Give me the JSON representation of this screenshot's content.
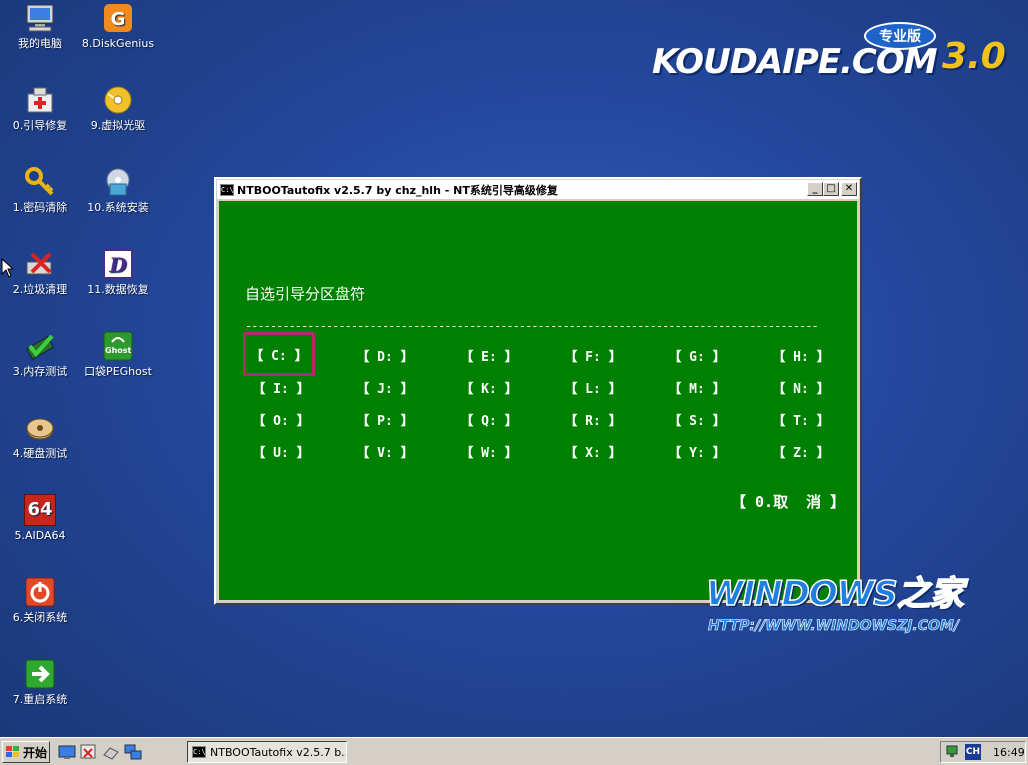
{
  "desktop": {
    "icons": [
      {
        "label": "我的电脑",
        "icon": "computer-icon"
      },
      {
        "label": "8.DiskGenius",
        "icon": "diskgenius-icon"
      },
      {
        "label": "0.引导修复",
        "icon": "boot-repair-icon"
      },
      {
        "label": "9.虚拟光驱",
        "icon": "virtual-cd-icon"
      },
      {
        "label": "1.密码清除",
        "icon": "key-icon"
      },
      {
        "label": "10.系统安装",
        "icon": "install-icon"
      },
      {
        "label": "2.垃圾清理",
        "icon": "cleaner-icon"
      },
      {
        "label": "11.数据恢复",
        "icon": "data-recovery-icon"
      },
      {
        "label": "3.内存测试",
        "icon": "memory-test-icon"
      },
      {
        "label": "口袋PEGhost",
        "icon": "ghost-icon"
      },
      {
        "label": "4.硬盘测试",
        "icon": "disk-test-icon"
      },
      {
        "label": "5.AIDA64",
        "icon": "aida64-icon",
        "glyph": "64"
      },
      {
        "label": "6.关闭系统",
        "icon": "shutdown-icon"
      },
      {
        "label": "7.重启系统",
        "icon": "restart-icon"
      }
    ],
    "ghost_badge": "Ghost",
    "logo": {
      "brand": "KOUDAIPE.COM",
      "badge": "专业版",
      "version": "3.0"
    },
    "watermark": {
      "title": "WINDOWS之家",
      "url": "HTTP://WWW.WINDOWSZJ.COM/"
    }
  },
  "console_window": {
    "title": "NTBOOTautofix v2.5.7 by chz_hlh - NT系统引导高级修复",
    "app_icon": "C:\\",
    "buttons": {
      "minimize": "_",
      "maximize": "□",
      "close": "✕"
    },
    "prompt": "自选引导分区盘符",
    "rule": "--------------------------------------------------------------------------------------------",
    "drives": [
      "【 C: 】",
      "【 D: 】",
      "【 E: 】",
      "【 F: 】",
      "【 G: 】",
      "【 H: 】",
      "【 I: 】",
      "【 J: 】",
      "【 K: 】",
      "【 L: 】",
      "【 M: 】",
      "【 N: 】",
      "【 O: 】",
      "【 P: 】",
      "【 Q: 】",
      "【 R: 】",
      "【 S: 】",
      "【 T: 】",
      "【 U: 】",
      "【 V: 】",
      "【 W: 】",
      "【 X: 】",
      "【 Y: 】",
      "【 Z: 】"
    ],
    "selected_drive": "【 C: 】",
    "cancel": "【 0.取  消 】",
    "colors": {
      "background": "#008000",
      "text": "#ffffff",
      "highlight": "#b22a6a"
    }
  },
  "taskbar": {
    "start_label": "开始",
    "task_label": "NTBOOTautofix v2.5.7 b...",
    "language": "CH",
    "clock": "16:49"
  }
}
